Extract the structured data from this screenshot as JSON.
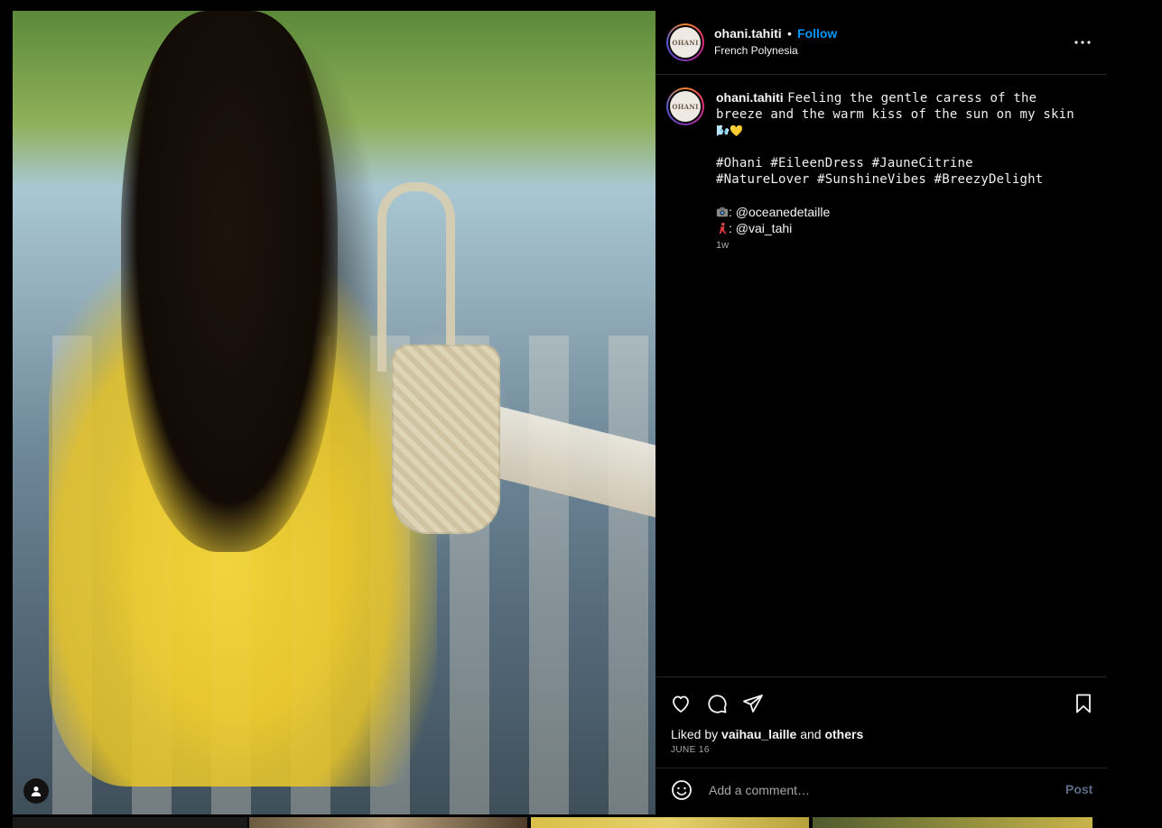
{
  "post": {
    "author": "ohani.tahiti",
    "separator": "•",
    "follow_label": "Follow",
    "location": "French Polynesia",
    "avatar_text": "OHANI",
    "more_icon": "more-horizontal-icon"
  },
  "caption": {
    "username": "ohani.tahiti",
    "line1": "Feeling the gentle caress of the",
    "line2": "breeze and the warm kiss of the sun on my skin",
    "emoji_line": "🌬️💛",
    "hashtags_line1": "#Ohani #EileenDress #JauneCitrine",
    "hashtags_line2": "#NatureLover #SunshineVibes #BreezyDelight",
    "photo_credit": ": @oceanedetaille",
    "model_credit": ": @vai_tahi",
    "photo_credit_icon": "camera-icon",
    "model_credit_icon": "dancer-icon",
    "time": "1w"
  },
  "actions": {
    "like_icon": "heart-icon",
    "comment_icon": "comment-icon",
    "share_icon": "send-icon",
    "save_icon": "bookmark-icon"
  },
  "likes": {
    "prefix": "Liked by",
    "user": "vaihau_laille",
    "and": "and",
    "others": "others",
    "date": "JUNE 16"
  },
  "comment_box": {
    "placeholder": "Add a comment…",
    "post_label": "Post",
    "emoji_icon": "smiley-icon"
  },
  "colors": {
    "background": "#000000",
    "text": "#f5f5f5",
    "link_blue": "#0095f6",
    "muted": "#a8a8a8",
    "post_disabled": "#5c6b85",
    "divider": "#262626"
  }
}
